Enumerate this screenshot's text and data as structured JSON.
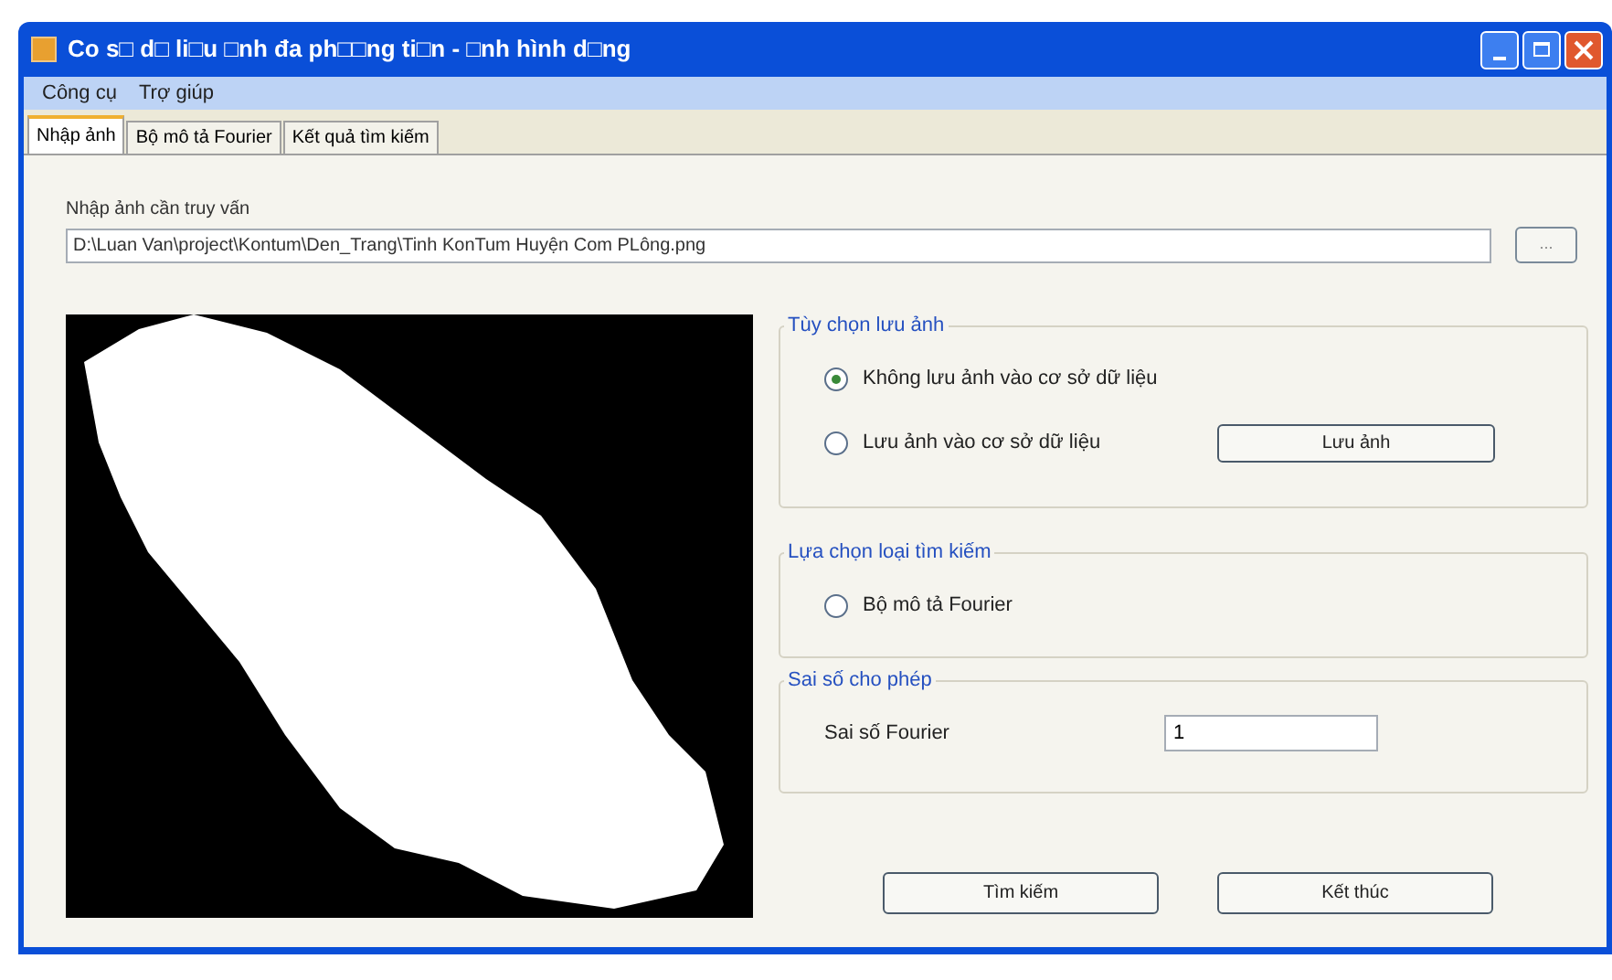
{
  "window": {
    "title": "Co s□ d□ li□u □nh đa ph□□ng ti□n - □nh hình d□ng"
  },
  "menu": [
    "Công cụ",
    "Trợ giúp"
  ],
  "tabs": [
    {
      "label": "Nhập ảnh",
      "selected": true
    },
    {
      "label": "Bộ mô tả Fourier",
      "selected": false
    },
    {
      "label": "Kết quả tìm kiếm",
      "selected": false
    }
  ],
  "query": {
    "label": "Nhập ảnh cần truy vấn",
    "value": "D:\\Luan Van\\project\\Kontum\\Den_Trang\\Tinh KonTum Huyện Com PLông.png",
    "browse": "..."
  },
  "save_options": {
    "title": "Tùy chọn lưu ảnh",
    "options": [
      {
        "label": "Không lưu ảnh vào cơ sở dữ liệu",
        "selected": true
      },
      {
        "label": "Lưu ảnh vào cơ sở dữ liệu",
        "selected": false
      }
    ],
    "button": "Lưu ảnh"
  },
  "search_type": {
    "title": "Lựa chọn loại tìm kiếm",
    "options": [
      {
        "label": "Bộ mô tả Fourier",
        "selected": false
      }
    ]
  },
  "tolerance": {
    "title": "Sai số cho phép",
    "label": "Sai số Fourier",
    "value": "1"
  },
  "buttons": [
    "Tìm kiếm",
    "Kết thúc"
  ]
}
